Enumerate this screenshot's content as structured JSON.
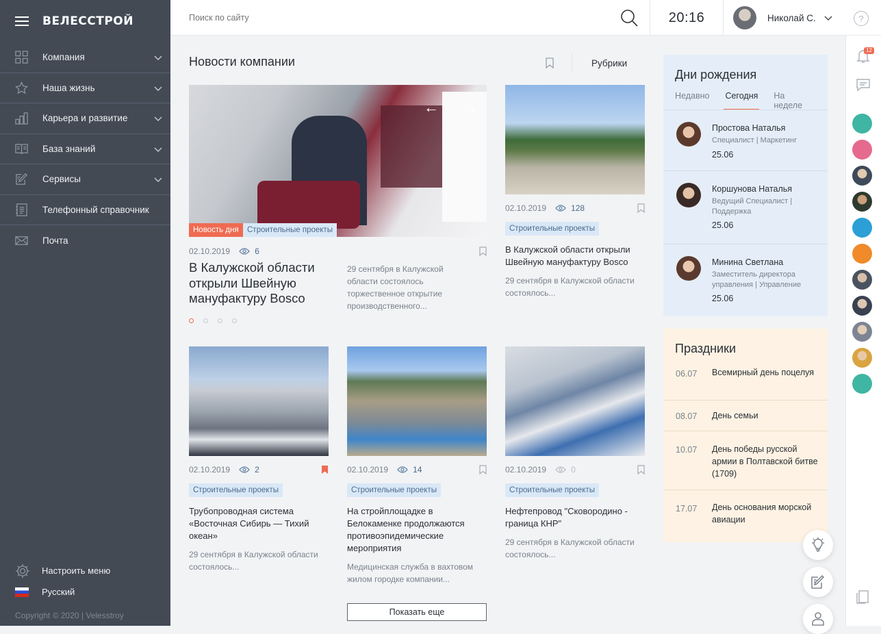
{
  "sidebar": {
    "logo": "ВЕЛЕССТРОЙ",
    "items": [
      {
        "label": "Компания",
        "icon": "grid-icon",
        "has_chevron": true
      },
      {
        "label": "Наша жизнь",
        "icon": "star-icon",
        "has_chevron": true
      },
      {
        "label": "Карьера и развитие",
        "icon": "bar-chart-icon",
        "has_chevron": true
      },
      {
        "label": "База знаний",
        "icon": "book-icon",
        "has_chevron": true
      },
      {
        "label": "Сервисы",
        "icon": "edit-icon",
        "has_chevron": true
      },
      {
        "label": "Телефонный справочник",
        "icon": "phonebook-icon",
        "has_chevron": false
      },
      {
        "label": "Почта",
        "icon": "mail-icon",
        "has_chevron": false
      }
    ],
    "settings_label": "Настроить меню",
    "language_label": "Русский",
    "copyright": "Copyright © 2020  |  Velesstroy"
  },
  "topbar": {
    "search_placeholder": "Поиск по сайту",
    "time": "20:16",
    "user_name": "Николай С.",
    "help": "?"
  },
  "news": {
    "title": "Новости компании",
    "rubrics_label": "Рубрики",
    "hero": {
      "badge": "Новость дня",
      "tag": "Строительные проекты",
      "date": "02.10.2019",
      "views": "6",
      "title": "В Калужской области открыли Швейную мануфактуру Bosco",
      "desc": "29 сентября в Калужской области состоялось торжественное открытие производственного..."
    },
    "side_card": {
      "date": "02.10.2019",
      "views": "128",
      "tag": "Строительные проекты",
      "title": "В Калужской области открыли Швейную мануфактуру Bosco",
      "desc": "29 сентября в Калужской области состоялось..."
    },
    "cards": [
      {
        "date": "02.10.2019",
        "views": "2",
        "bookmarked": true,
        "tag": "Строительные проекты",
        "title": "Трубопроводная система «Восточная Сибирь — Тихий океан»",
        "desc": "29 сентября в Калужской области состоялось..."
      },
      {
        "date": "02.10.2019",
        "views": "14",
        "bookmarked": false,
        "tag": "Строительные проекты",
        "title": "На стройплощадке в Белокаменке продолжаются противоэпидемические мероприятия",
        "desc": "Медицинская служба в вахтовом жилом городке компании..."
      },
      {
        "date": "02.10.2019",
        "views": "0",
        "bookmarked": false,
        "tag": "Строительные проекты",
        "title": "Нефтепровод \"Сковородино - граница КНР\"",
        "desc": "29 сентября в Калужской области состоялось..."
      }
    ],
    "show_more": "Показать еще"
  },
  "birthdays": {
    "title": "Дни рождения",
    "tabs": [
      "Недавно",
      "Сегодня",
      "На неделе"
    ],
    "active_tab": "Сегодня",
    "people": [
      {
        "name": "Простова Наталья",
        "role": "Специалист  |  Маркетинг",
        "date": "25.06"
      },
      {
        "name": "Коршунова Наталья",
        "role": "Ведущий Специалист  |  Поддержка",
        "date": "25.06"
      },
      {
        "name": "Минина Светлана",
        "role": "Заместитель директора управления  |  Управление",
        "date": "25.06"
      }
    ]
  },
  "holidays": {
    "title": "Праздники",
    "items": [
      {
        "date": "06.07",
        "name": "Всемирный день поцелуя"
      },
      {
        "date": "08.07",
        "name": "День семьи"
      },
      {
        "date": "10.07",
        "name": "День победы русской армии в Полтавской битве (1709)"
      },
      {
        "date": "17.07",
        "name": "День основания морской авиации"
      }
    ]
  },
  "rail": {
    "notifications_count": "12"
  },
  "colors": {
    "sidebar": "#434a54",
    "accent": "#ef6b52",
    "tag_bg": "#d9e8f7",
    "birthday_bg": "#e5eef8",
    "holiday_bg": "#fdf2e3"
  }
}
